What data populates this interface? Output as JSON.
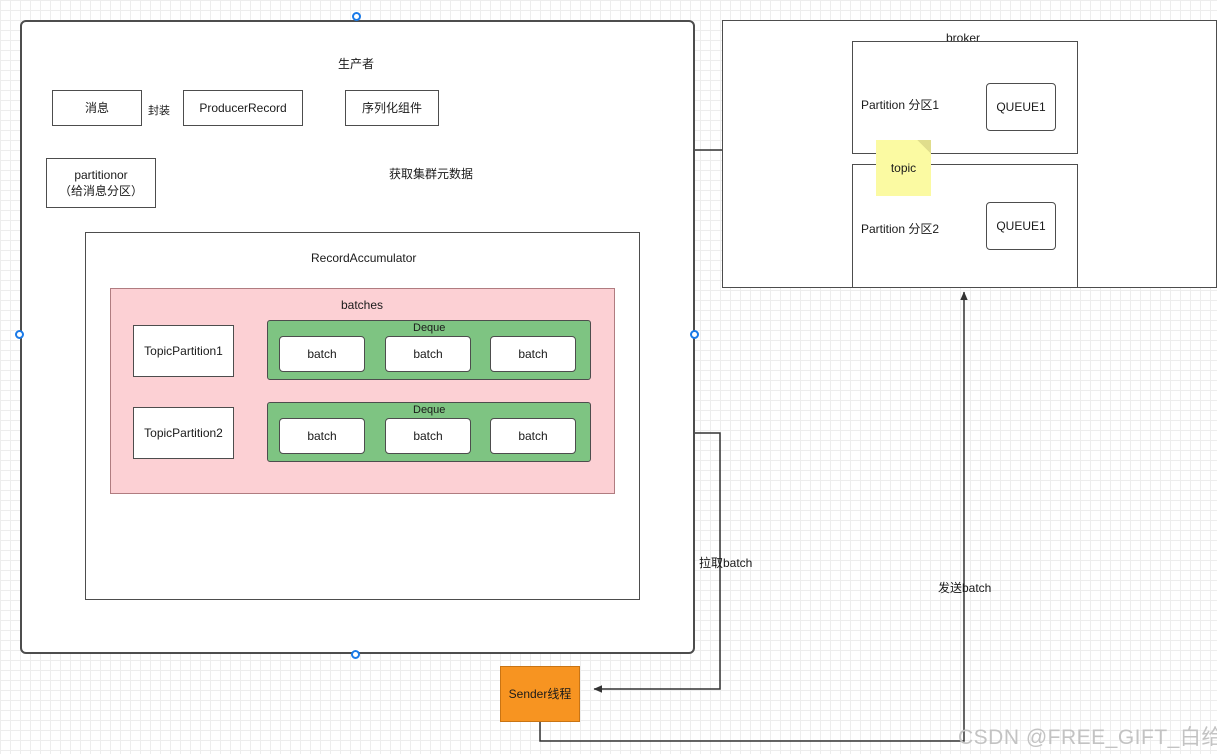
{
  "canvas": {
    "watermark": "CSDN @FREE_GIFT_白给怪",
    "grid": true,
    "colors": {
      "stroke": "#4d4d4d",
      "batches_pink": "#fcd0d4",
      "deque_green": "#7ec482",
      "sender_orange": "#f79421",
      "note_yellow": "#fbfaa2",
      "handle_blue": "#1a7ae8",
      "watermark_gray": "#c3c3c3"
    }
  },
  "producer": {
    "title": "生产者",
    "nodes": {
      "message": "消息",
      "producer_record": "ProducerRecord",
      "serializer": "序列化组件",
      "partitioner_line1": "partitionor",
      "partitioner_line2": "（给消息分区）"
    },
    "edge_labels": {
      "encapsulate": "封装",
      "fetch_metadata": "获取集群元数据"
    },
    "accumulator": {
      "title": "RecordAccumulator",
      "batches_title": "batches",
      "rows": [
        {
          "partition": "TopicPartition1",
          "deque_title": "Deque",
          "batches": [
            "batch",
            "batch",
            "batch"
          ]
        },
        {
          "partition": "TopicPartition2",
          "deque_title": "Deque",
          "batches": [
            "batch",
            "batch",
            "batch"
          ]
        }
      ]
    }
  },
  "broker": {
    "title": "broker",
    "note": "topic",
    "partitions": [
      {
        "label": "Partition 分区1",
        "queue": "QUEUE1"
      },
      {
        "label": "Partition 分区2",
        "queue": "QUEUE1"
      }
    ]
  },
  "sender": {
    "label": "Sender线程",
    "edge_labels": {
      "pull_batch": "拉取batch",
      "send_batch": "发送batch"
    }
  }
}
